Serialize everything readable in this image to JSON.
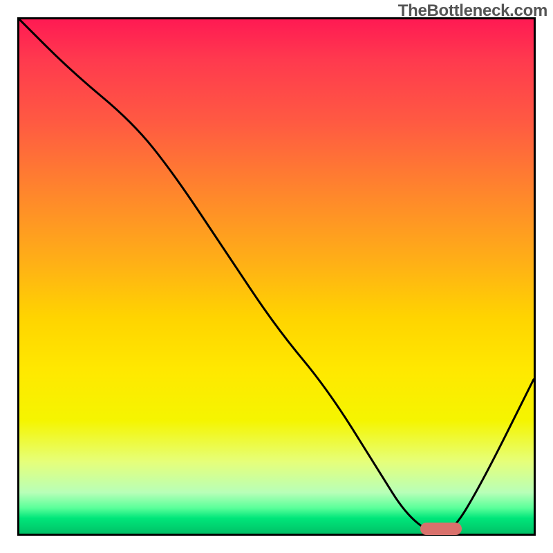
{
  "watermark": "TheBottleneck.com",
  "chart_data": {
    "type": "line",
    "title": "",
    "xlabel": "",
    "ylabel": "",
    "xlim": [
      0,
      100
    ],
    "ylim": [
      0,
      100
    ],
    "grid": false,
    "legend": false,
    "background_gradient": {
      "orientation": "vertical",
      "stops": [
        {
          "pos": 0.0,
          "color": "#ff1a53",
          "meaning": "high-bottleneck"
        },
        {
          "pos": 0.5,
          "color": "#ffd400",
          "meaning": "mid"
        },
        {
          "pos": 0.97,
          "color": "#00e67a",
          "meaning": "no-bottleneck"
        }
      ]
    },
    "series": [
      {
        "name": "bottleneck-curve",
        "x": [
          0,
          10,
          22,
          30,
          40,
          50,
          60,
          70,
          75,
          80,
          84,
          90,
          100
        ],
        "values": [
          100,
          90,
          80,
          70,
          55,
          40,
          28,
          12,
          4,
          0,
          0,
          10,
          30
        ]
      }
    ],
    "highlight_marker": {
      "x_start": 78,
      "x_end": 86,
      "y": 1,
      "color": "#d9716c",
      "shape": "rounded-bar"
    }
  }
}
